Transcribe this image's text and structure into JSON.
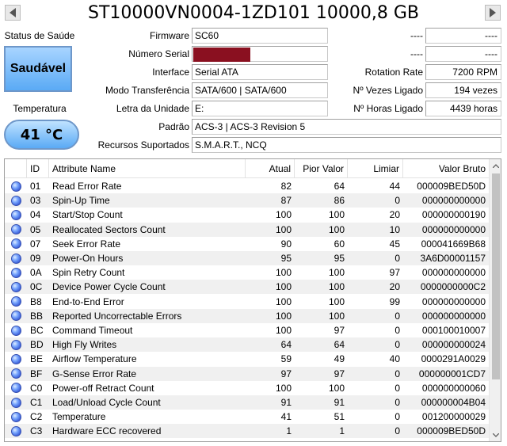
{
  "title": "ST10000VN0004-1ZD101 10000,8 GB",
  "status": {
    "health_label": "Status de Saúde",
    "health_value": "Saudável",
    "temp_label": "Temperatura",
    "temp_value": "41 °C",
    "colors": {
      "health_bg": "#5aaaf5",
      "temp_bg": "#5aaaf5"
    }
  },
  "info": {
    "firmware_label": "Firmware",
    "firmware": "SC60",
    "serial_label": "Número Serial",
    "serial": "",
    "interface_label": "Interface",
    "interface": "Serial ATA",
    "transfer_label": "Modo Transferência",
    "transfer": "SATA/600 | SATA/600",
    "drive_letter_label": "Letra da Unidade",
    "drive_letter": "E:",
    "standard_label": "Padrão",
    "standard": "ACS-3 | ACS-3 Revision 5",
    "features_label": "Recursos Suportados",
    "features": "S.M.A.R.T., NCQ",
    "right1_label": "----",
    "right1": "----",
    "right2_label": "----",
    "right2": "----",
    "rotation_label": "Rotation Rate",
    "rotation": "7200 RPM",
    "power_count_label": "Nº Vezes Ligado",
    "power_count": "194 vezes",
    "power_hours_label": "Nº Horas Ligado",
    "power_hours": "4439 horas"
  },
  "table": {
    "headers": [
      "",
      "ID",
      "Attribute Name",
      "Atual",
      "Pior Valor",
      "Limiar",
      "Valor Bruto"
    ],
    "rows": [
      [
        "01",
        "Read Error Rate",
        "82",
        "64",
        "44",
        "000009BED50D"
      ],
      [
        "03",
        "Spin-Up Time",
        "87",
        "86",
        "0",
        "000000000000"
      ],
      [
        "04",
        "Start/Stop Count",
        "100",
        "100",
        "20",
        "000000000190"
      ],
      [
        "05",
        "Reallocated Sectors Count",
        "100",
        "100",
        "10",
        "000000000000"
      ],
      [
        "07",
        "Seek Error Rate",
        "90",
        "60",
        "45",
        "000041669B68"
      ],
      [
        "09",
        "Power-On Hours",
        "95",
        "95",
        "0",
        "3A6D00001157"
      ],
      [
        "0A",
        "Spin Retry Count",
        "100",
        "100",
        "97",
        "000000000000"
      ],
      [
        "0C",
        "Device Power Cycle Count",
        "100",
        "100",
        "20",
        "0000000000C2"
      ],
      [
        "B8",
        "End-to-End Error",
        "100",
        "100",
        "99",
        "000000000000"
      ],
      [
        "BB",
        "Reported Uncorrectable Errors",
        "100",
        "100",
        "0",
        "000000000000"
      ],
      [
        "BC",
        "Command Timeout",
        "100",
        "97",
        "0",
        "000100010007"
      ],
      [
        "BD",
        "High Fly Writes",
        "64",
        "64",
        "0",
        "000000000024"
      ],
      [
        "BE",
        "Airflow Temperature",
        "59",
        "49",
        "40",
        "0000291A0029"
      ],
      [
        "BF",
        "G-Sense Error Rate",
        "97",
        "97",
        "0",
        "000000001CD7"
      ],
      [
        "C0",
        "Power-off Retract Count",
        "100",
        "100",
        "0",
        "000000000060"
      ],
      [
        "C1",
        "Load/Unload Cycle Count",
        "91",
        "91",
        "0",
        "000000004B04"
      ],
      [
        "C2",
        "Temperature",
        "41",
        "51",
        "0",
        "001200000029"
      ],
      [
        "C3",
        "Hardware ECC recovered",
        "1",
        "1",
        "0",
        "000009BED50D"
      ]
    ],
    "status_icon": "good-status-dot-icon"
  },
  "nav": {
    "prev_icon": "triangle-left-icon",
    "next_icon": "triangle-right-icon"
  }
}
